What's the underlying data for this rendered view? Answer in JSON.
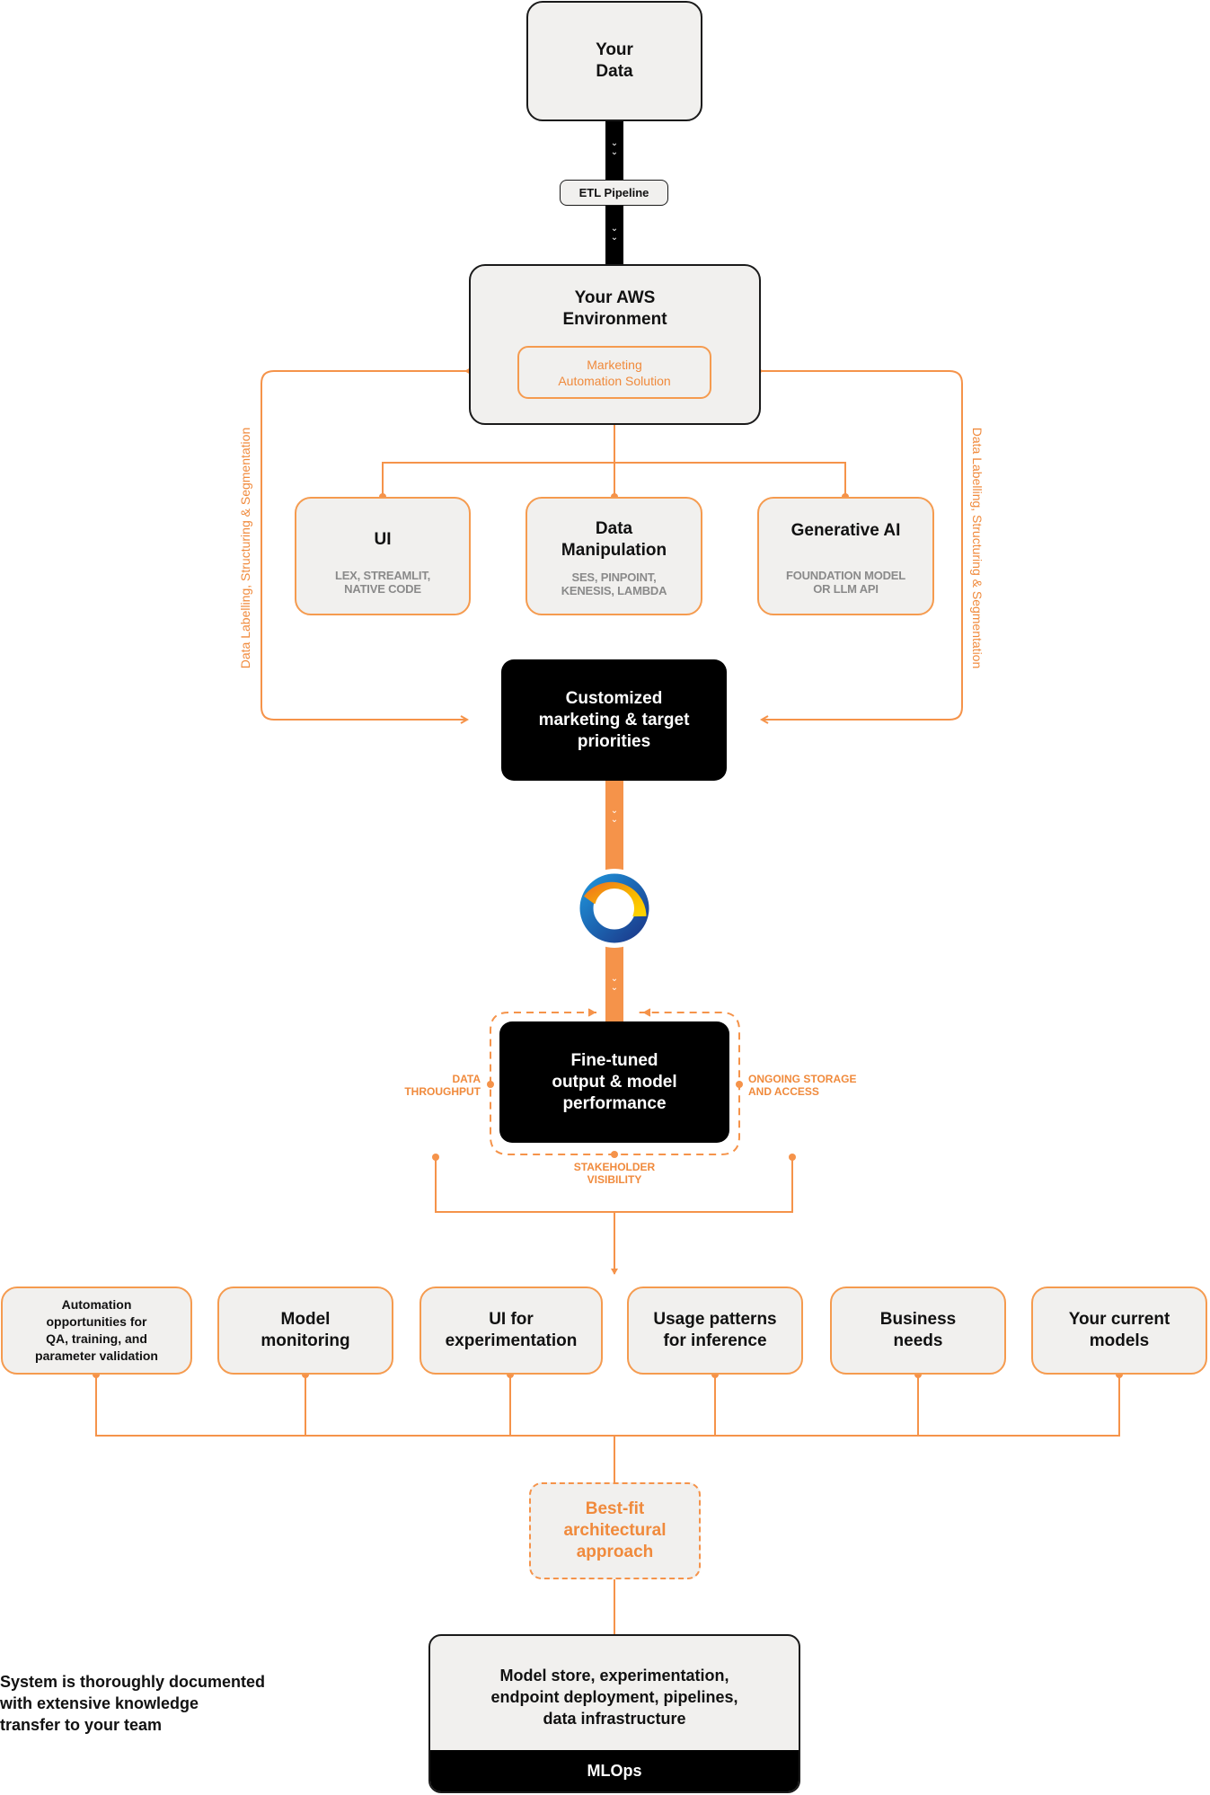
{
  "colors": {
    "accent": "#f5934a",
    "box_fill": "#f1f0ee",
    "dark": "#000000",
    "muted_text": "#8a8a8a"
  },
  "top": {
    "your_data": [
      "Your",
      "Data"
    ],
    "etl": "ETL Pipeline",
    "aws": [
      "Your AWS",
      "Environment"
    ],
    "marketing": [
      "Marketing",
      "Automation Solution"
    ]
  },
  "loop_labels": {
    "left": "Data Labelling, Structuring & Segmentation",
    "right": "Data Labelling, Structuring & Segmentation"
  },
  "services": [
    {
      "title": [
        "UI"
      ],
      "sub": [
        "LEX, STREAMLIT,",
        "NATIVE CODE"
      ]
    },
    {
      "title": [
        "Data",
        "Manipulation"
      ],
      "sub": [
        "SES, PINPOINT,",
        "KENESIS, LAMBDA"
      ]
    },
    {
      "title": [
        "Generative AI"
      ],
      "sub": [
        "FOUNDATION MODEL",
        "OR LLM API"
      ]
    }
  ],
  "customized": [
    "Customized",
    "marketing & target",
    "priorities"
  ],
  "logo": {
    "name": "circular-logo-icon"
  },
  "finetuned": {
    "title": [
      "Fine-tuned",
      "output & model",
      "performance"
    ],
    "left_label": [
      "DATA",
      "THROUGHPUT"
    ],
    "right_label": [
      "ONGOING STORAGE",
      "AND ACCESS"
    ],
    "bottom_label": [
      "STAKEHOLDER",
      "VISIBILITY"
    ]
  },
  "inputs": [
    [
      "Automation",
      "opportunities for",
      "QA, training, and",
      "parameter validation"
    ],
    [
      "Model",
      "monitoring"
    ],
    [
      "UI for",
      "experimentation"
    ],
    [
      "Usage patterns",
      "for inference"
    ],
    [
      "Business",
      "needs"
    ],
    [
      "Your current",
      "models"
    ]
  ],
  "bestfit": [
    "Best-fit",
    "architectural",
    "approach"
  ],
  "mlops": {
    "body": [
      "Model store, experimentation,",
      "endpoint deployment, pipelines,",
      "data infrastructure"
    ],
    "band": "MLOps"
  },
  "documentation_note": [
    "System is thoroughly documented",
    "with extensive knowledge",
    "transfer to your team"
  ]
}
